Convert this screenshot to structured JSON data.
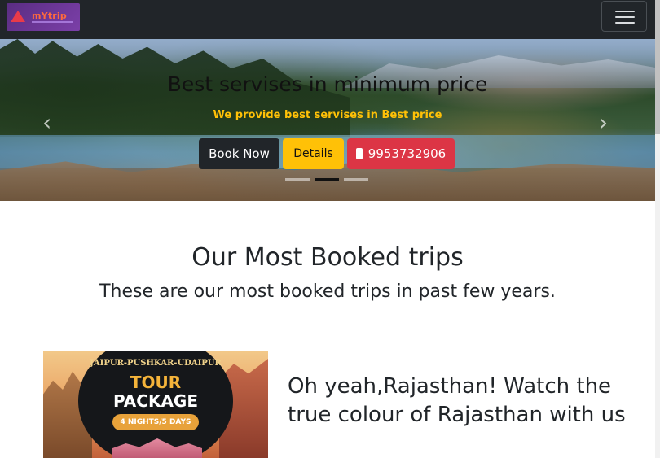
{
  "navbar": {
    "brand": {
      "logo_text": "mYtrip"
    },
    "toggle_icon": "hamburger-icon"
  },
  "hero": {
    "title": "Best servises in minimum price",
    "subtitle": "We provide best servises in Best price",
    "buttons": {
      "book_now": "Book Now",
      "details": "Details",
      "phone": "9953732906",
      "phone_icon": "phone-icon"
    },
    "indicators": {
      "count": 3,
      "active_index": 1
    },
    "prev_icon": "chevron-left-icon",
    "next_icon": "chevron-right-icon"
  },
  "section": {
    "title": "Our Most Booked trips",
    "subtitle": "These are our most booked trips in past few years."
  },
  "trip": {
    "image_text": {
      "line1": "JAIPUR-PUSHKAR-UDAIPUR",
      "line2": "TOUR",
      "line3": "PACKAGE",
      "duration": "4 NIGHTS/5 DAYS"
    },
    "heading": "Oh yeah,Rajasthan! Watch the true colour of Rajasthan with us"
  },
  "colors": {
    "navbar_bg": "#212529",
    "warning": "#ffc107",
    "danger": "#dc3545",
    "dark": "#212529"
  }
}
